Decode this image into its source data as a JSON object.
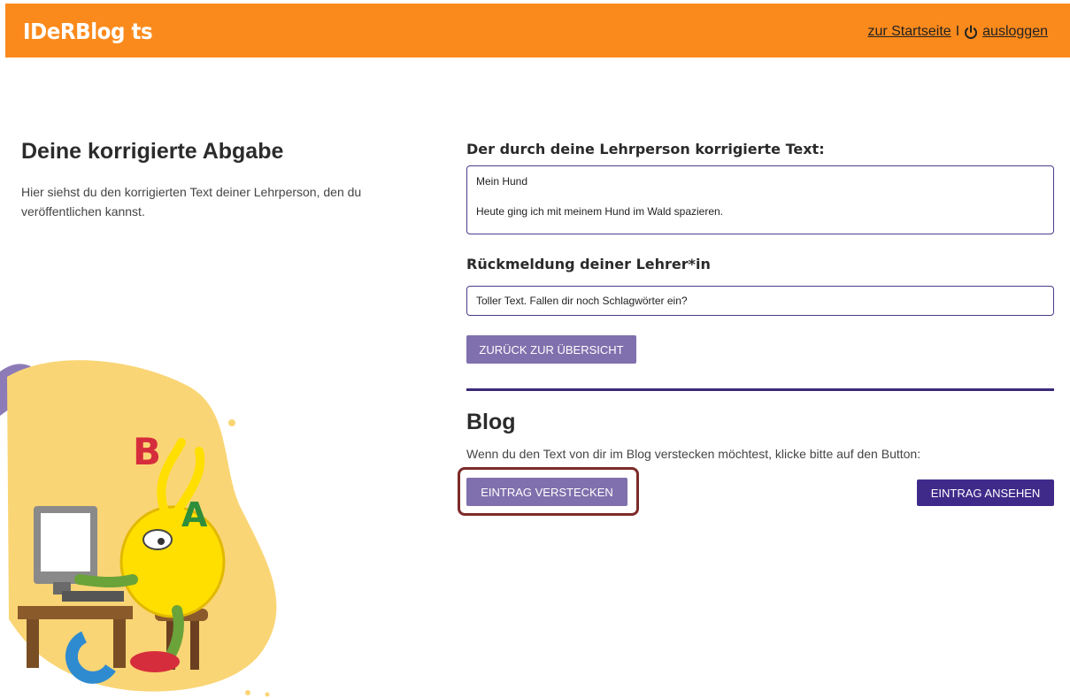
{
  "header": {
    "logo": "IDeRBlog ts",
    "home_link": "zur Startseite",
    "separator": "I",
    "logout_link": "ausloggen",
    "color": "#fb8a1c"
  },
  "left": {
    "title": "Deine korrigierte Abgabe",
    "description": "Hier siehst du den korrigierten Text deiner Lehrperson, den du veröffentlichen kannst."
  },
  "corrected": {
    "heading": "Der durch deine Lehrperson korrigierte Text:",
    "line1": "Mein Hund",
    "line2": "Heute ging ich mit meinem Hund im Wald spazieren."
  },
  "feedback": {
    "heading": "Rückmeldung deiner Lehrer*in",
    "text": "Toller Text. Fallen dir noch Schlagwörter ein?"
  },
  "back_button": "ZURÜCK ZUR ÜBERSICHT",
  "blog": {
    "title": "Blog",
    "description": "Wenn du den Text von dir im Blog verstecken möchtest, klicke bitte auf den Button:",
    "hide_button": "EINTRAG VERSTECKEN",
    "view_button": "EINTRAG ANSEHEN"
  },
  "illustration": {
    "letters": [
      "B",
      "A"
    ]
  },
  "colors": {
    "accent_light": "#8070ad",
    "accent_dark": "#3f2a8a",
    "highlight": "#7d2a2a"
  }
}
